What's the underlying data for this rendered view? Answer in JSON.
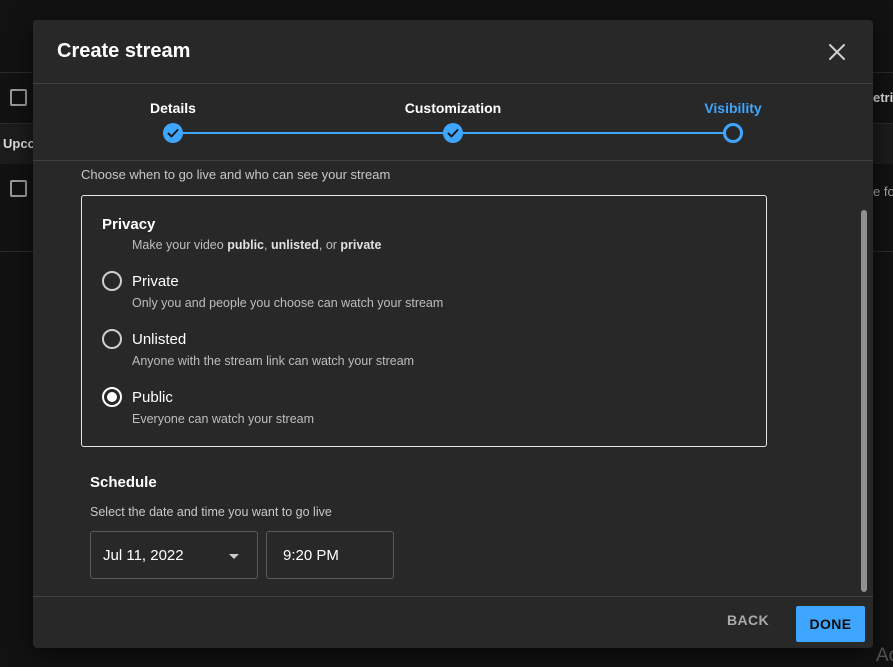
{
  "background": {
    "upcoming_tab_partial": "Upco",
    "metrics_partial": "etric",
    "row_text_partial": "e fo",
    "watermark_partial": "Ac"
  },
  "dialog": {
    "title": "Create stream",
    "close_icon": "close-icon"
  },
  "stepper": {
    "steps": [
      {
        "label": "Details",
        "state": "done"
      },
      {
        "label": "Customization",
        "state": "done"
      },
      {
        "label": "Visibility",
        "state": "current"
      }
    ],
    "accent": "#3ea6ff"
  },
  "visibility": {
    "subtitle": "Choose when to go live and who can see your stream",
    "privacy": {
      "title": "Privacy",
      "desc_prefix": "Make your video ",
      "desc_public": "public",
      "desc_sep1": ", ",
      "desc_unlisted": "unlisted",
      "desc_sep2": ", or ",
      "desc_private": "private",
      "options": [
        {
          "label": "Private",
          "desc": "Only you and people you choose can watch your stream",
          "selected": false
        },
        {
          "label": "Unlisted",
          "desc": "Anyone with the stream link can watch your stream",
          "selected": false
        },
        {
          "label": "Public",
          "desc": "Everyone can watch your stream",
          "selected": true
        }
      ]
    },
    "schedule": {
      "title": "Schedule",
      "desc": "Select the date and time you want to go live",
      "date": "Jul 11, 2022",
      "time": "9:20 PM"
    }
  },
  "footer": {
    "back_label": "BACK",
    "done_label": "DONE"
  }
}
